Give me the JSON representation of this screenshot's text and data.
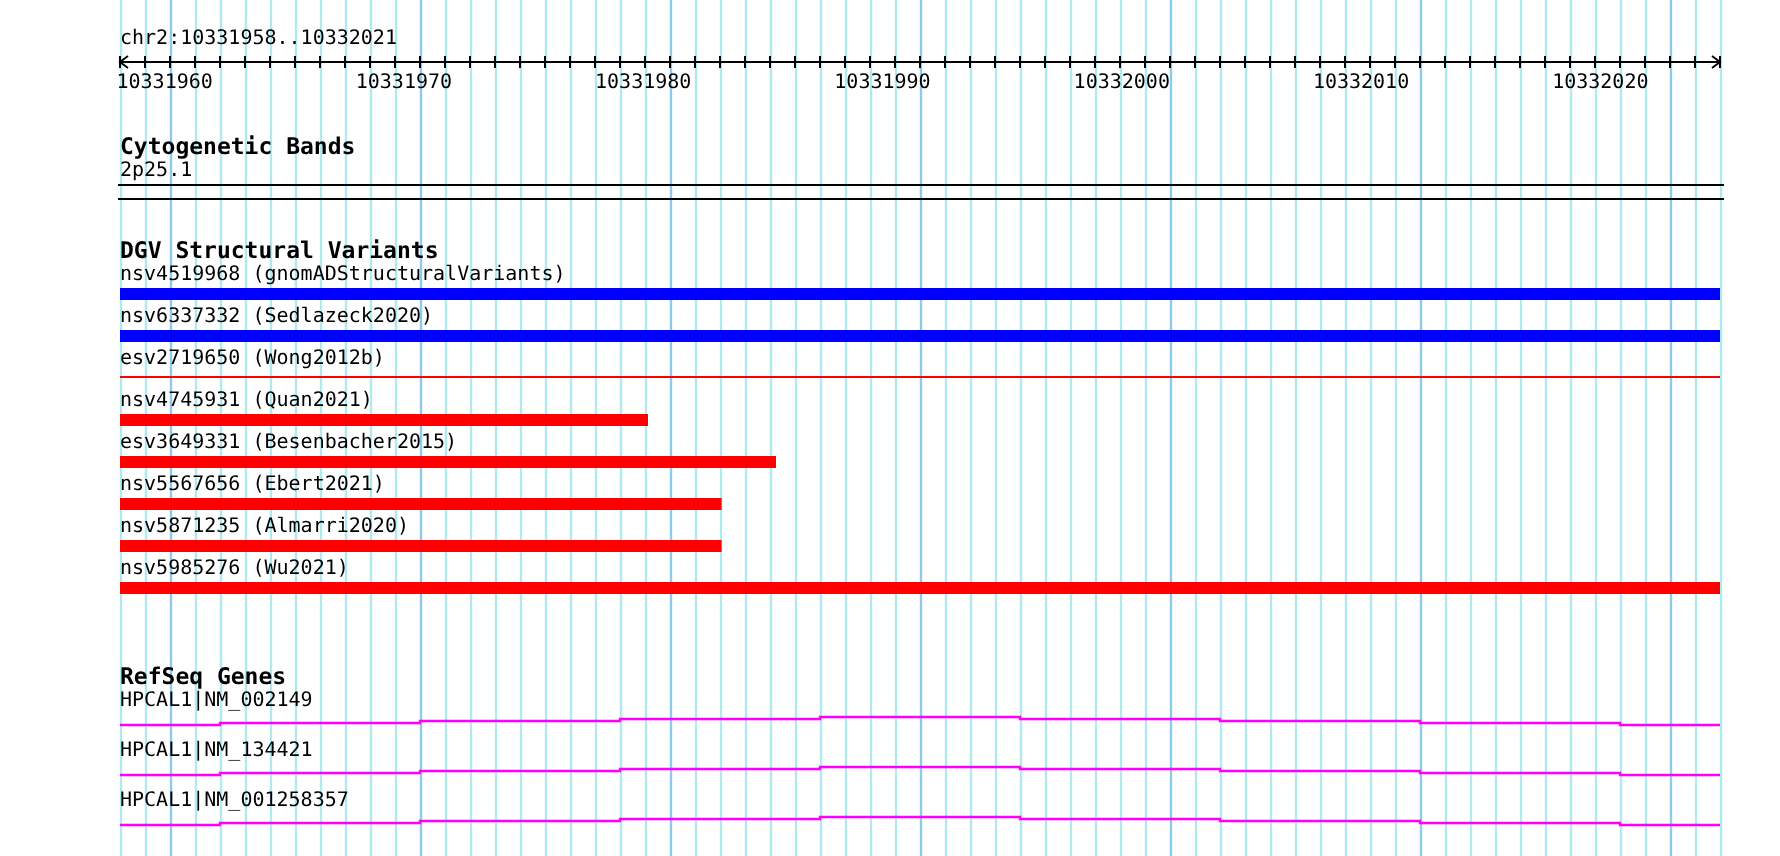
{
  "location": "chr2:10331958..10332021",
  "ruler": {
    "labels": [
      "10331960",
      "10331970",
      "10331980",
      "10331990",
      "10332000",
      "10332010",
      "10332020"
    ]
  },
  "cytogenetic_bands": {
    "title": "Cytogenetic Bands",
    "band": "2p25.1"
  },
  "dgv": {
    "title": "DGV Structural Variants",
    "variants": [
      {
        "label": "nsv4519968 (gnomADStructuralVariants)",
        "kind": "bar",
        "level": 1,
        "color": "#0000ff"
      },
      {
        "label": "nsv6337332 (Sedlazeck2020)",
        "kind": "bar",
        "level": 1,
        "color": "#0000ff"
      },
      {
        "label": "esv2719650 (Wong2012b)",
        "kind": "line",
        "level": 1,
        "color": "#ff0000"
      },
      {
        "label": "nsv4745931 (Quan2021)",
        "kind": "bar",
        "level": 0.33,
        "color": "#ff0000"
      },
      {
        "label": "esv3649331 (Besenbacher2015)",
        "kind": "bar",
        "level": 0.41,
        "color": "#ff0000"
      },
      {
        "label": "nsv5567656 (Ebert2021)",
        "kind": "bar",
        "level": 0.376,
        "color": "#ff0000"
      },
      {
        "label": "nsv5871235 (Almarri2020)",
        "kind": "bar",
        "level": 0.376,
        "color": "#ff0000"
      },
      {
        "label": "nsv5985276 (Wu2021)",
        "kind": "bar",
        "level": 1,
        "color": "#ff0000"
      }
    ]
  },
  "refseq": {
    "title": "RefSeq Genes",
    "genes": [
      {
        "label": "HPCAL1|NM_002149"
      },
      {
        "label": "HPCAL1|NM_134421"
      },
      {
        "label": "HPCAL1|NM_001258357"
      }
    ]
  }
}
